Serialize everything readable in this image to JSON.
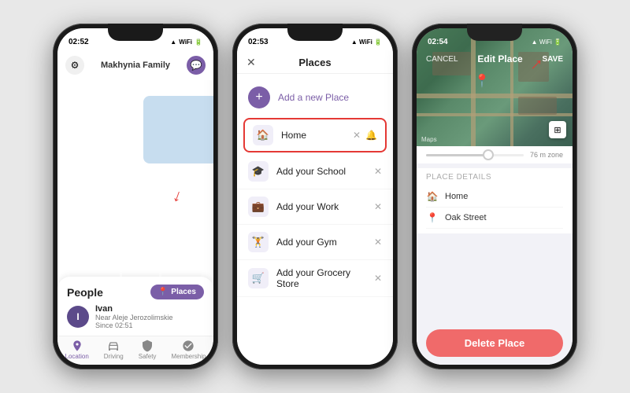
{
  "phone1": {
    "statusBar": {
      "time": "02:52",
      "icons": "▲ ◀ ■ 🔋"
    },
    "header": {
      "title": "Makhynia Family"
    },
    "bottomPanel": {
      "peopleTitle": "People",
      "placesBtn": "Places",
      "person": {
        "name": "Ivan",
        "location": "Near Aleje Jerozolimskie",
        "since": "Since 02:51"
      }
    },
    "tabs": [
      {
        "label": "Location",
        "icon": "location"
      },
      {
        "label": "Driving",
        "icon": "driving"
      },
      {
        "label": "Safety",
        "icon": "safety"
      },
      {
        "label": "Membership",
        "icon": "membership"
      }
    ]
  },
  "phone2": {
    "statusBar": {
      "time": "02:53"
    },
    "title": "Places",
    "closeIcon": "✕",
    "addNew": "Add a new Place",
    "places": [
      {
        "label": "Home",
        "icon": "🏠",
        "highlighted": true
      },
      {
        "label": "Add your School",
        "icon": "🎓"
      },
      {
        "label": "Add your Work",
        "icon": "💼"
      },
      {
        "label": "Add your Gym",
        "icon": "🏋"
      },
      {
        "label": "Add your Grocery Store",
        "icon": "🛒"
      }
    ]
  },
  "phone3": {
    "statusBar": {
      "time": "02:54"
    },
    "nav": {
      "cancel": "CANCEL",
      "title": "Edit Place",
      "save": "SAVE"
    },
    "radiusLabel": "76 m zone",
    "placeDetails": {
      "sectionTitle": "Place details",
      "name": "Home",
      "address": "Oak Street"
    },
    "deleteBtn": "Delete Place",
    "mapsLabel": "Maps"
  }
}
